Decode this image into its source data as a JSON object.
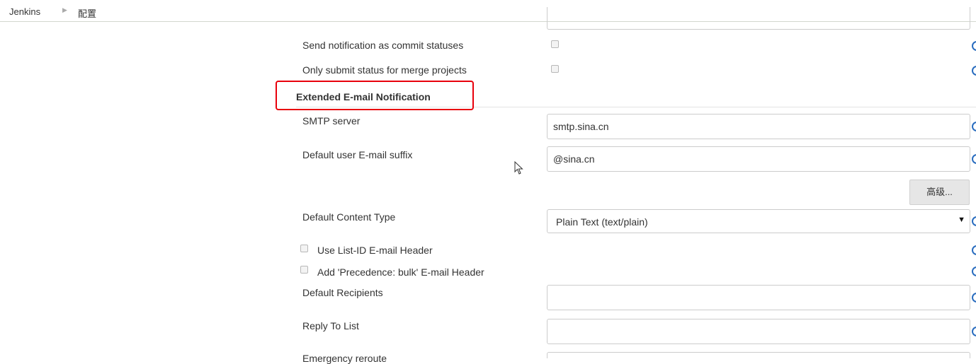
{
  "breadcrumb": {
    "root": "Jenkins",
    "current": "配置"
  },
  "github": {
    "commit_status_label": "Send notification as commit statuses",
    "merge_only_label": "Only submit status for merge projects"
  },
  "section": {
    "title": "Extended E-mail Notification"
  },
  "form": {
    "smtp_label": "SMTP server",
    "smtp_value": "smtp.sina.cn",
    "suffix_label": "Default user E-mail suffix",
    "suffix_value": "@sina.cn",
    "advanced_label": "高级...",
    "content_type_label": "Default Content Type",
    "content_type_value": "Plain Text (text/plain)",
    "list_id_label": "Use List-ID E-mail Header",
    "precedence_label": "Add 'Precedence: bulk' E-mail Header",
    "recipients_label": "Default Recipients",
    "recipients_value": "",
    "reply_to_label": "Reply To List",
    "reply_to_value": "",
    "emergency_label": "Emergency reroute"
  },
  "colors": {
    "highlight": "#e8000b",
    "help_icon": "#2a6dbf",
    "breadcrumb_border": "#d3d7cf"
  },
  "icons": {
    "breadcrumb_separator": "triangle-right",
    "help": "help-icon",
    "cursor": "mouse-pointer"
  }
}
